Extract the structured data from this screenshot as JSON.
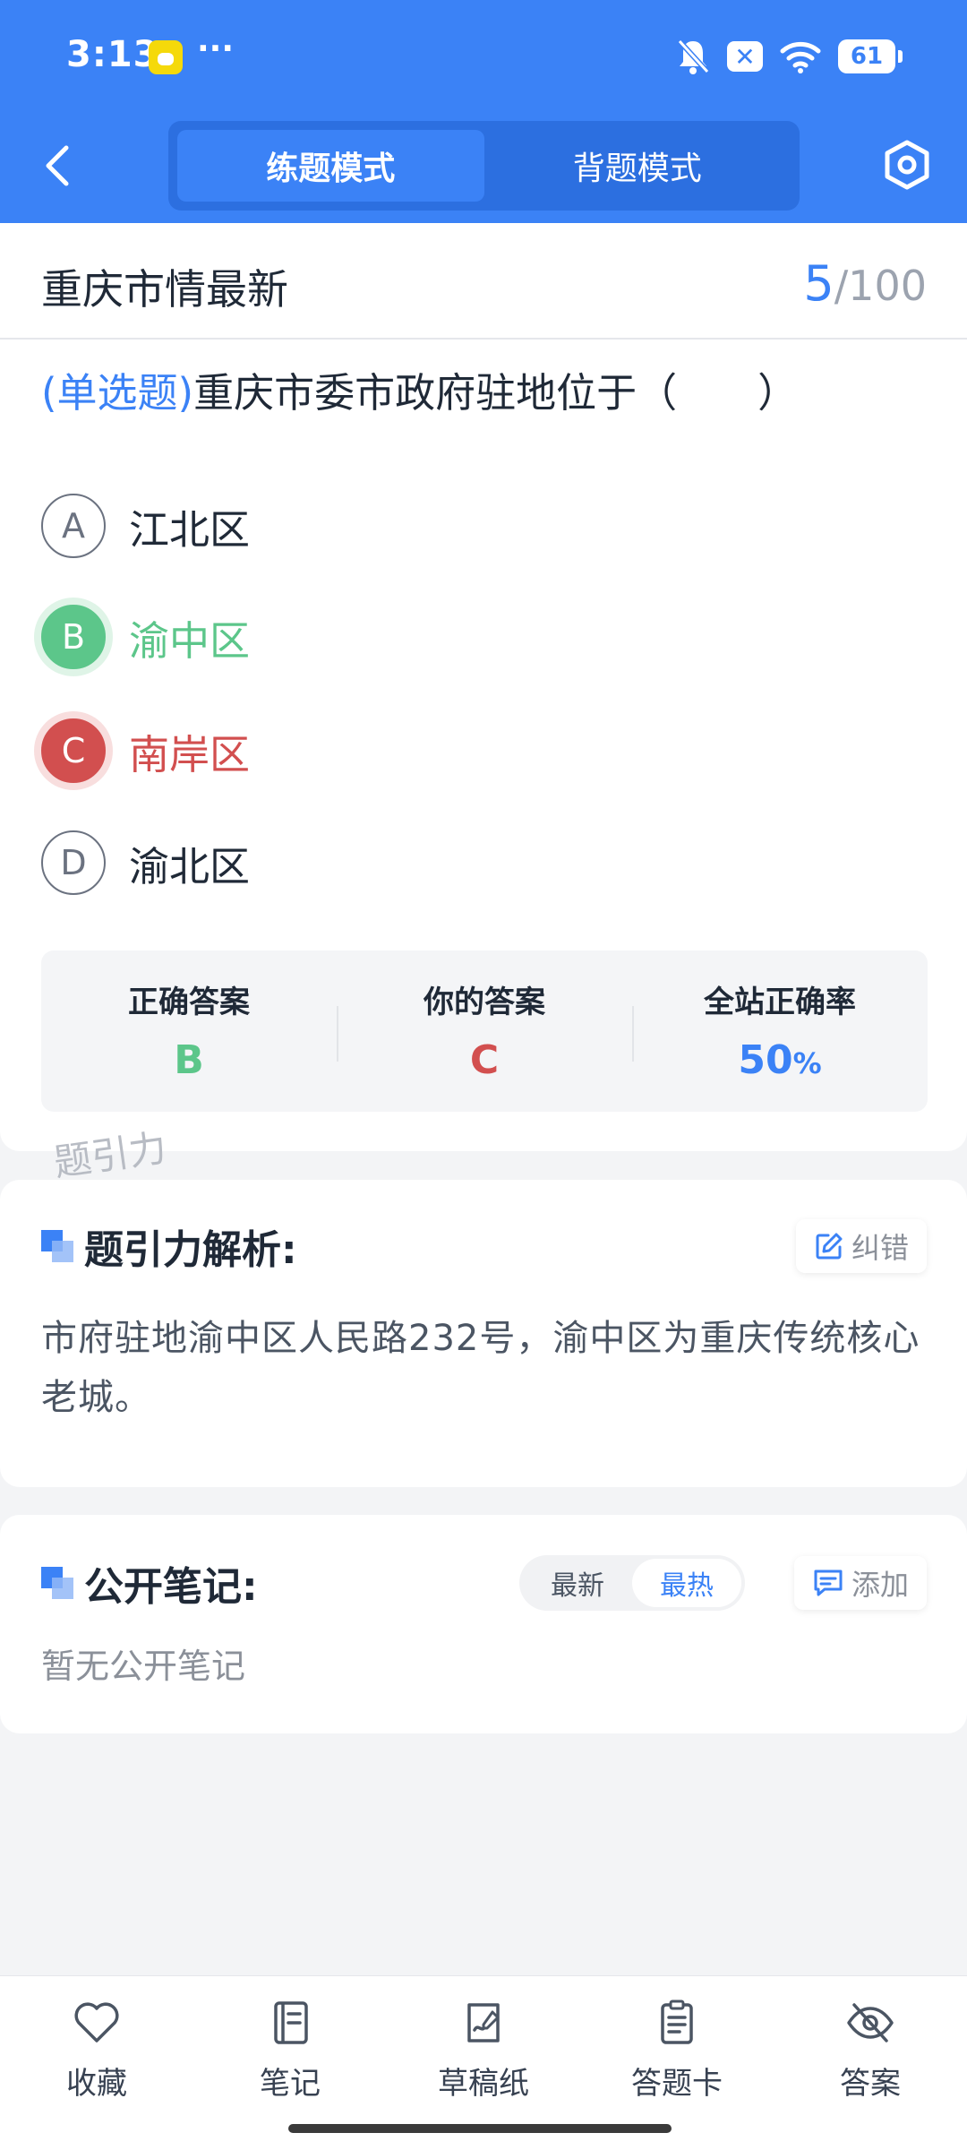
{
  "status_bar": {
    "time": "3:13",
    "dots": "···",
    "battery": "61",
    "icons": [
      "app-notification-icon",
      "mute-bell-icon",
      "close-badge-icon",
      "wifi-icon",
      "battery-icon"
    ]
  },
  "header": {
    "modes": [
      {
        "label": "练题模式",
        "active": true
      },
      {
        "label": "背题模式",
        "active": false
      }
    ]
  },
  "question": {
    "bank_title": "重庆市情最新",
    "current": "5",
    "total": "/100",
    "type": "(单选题)",
    "text": "重庆市委市政府驻地位于（　　）",
    "options": [
      {
        "letter": "A",
        "text": "江北区",
        "state": "normal"
      },
      {
        "letter": "B",
        "text": "渝中区",
        "state": "correct"
      },
      {
        "letter": "C",
        "text": "南岸区",
        "state": "wrong"
      },
      {
        "letter": "D",
        "text": "渝北区",
        "state": "normal"
      }
    ]
  },
  "stats": {
    "correct_label": "正确答案",
    "correct_value": "B",
    "yours_label": "你的答案",
    "yours_value": "C",
    "rate_label": "全站正确率",
    "rate_value": "50",
    "rate_unit": "%"
  },
  "watermark": "题引力",
  "analysis": {
    "title": "题引力解析:",
    "report_label": "纠错",
    "text": "市府驻地渝中区人民路232号，渝中区为重庆传统核心老城。"
  },
  "notes": {
    "title": "公开笔记:",
    "sort_options": [
      "最新",
      "最热"
    ],
    "active_sort": "最热",
    "add_label": "添加",
    "empty_text": "暂无公开笔记"
  },
  "bottom_nav": [
    {
      "label": "收藏",
      "icon": "heart-icon"
    },
    {
      "label": "笔记",
      "icon": "notebook-icon"
    },
    {
      "label": "草稿纸",
      "icon": "draft-paper-icon"
    },
    {
      "label": "答题卡",
      "icon": "answer-sheet-icon"
    },
    {
      "label": "答案",
      "icon": "eye-off-icon"
    }
  ],
  "colors": {
    "primary": "#3b82f6",
    "correct": "#5cc68a",
    "wrong": "#d24f4f",
    "background": "#f3f4f6"
  }
}
